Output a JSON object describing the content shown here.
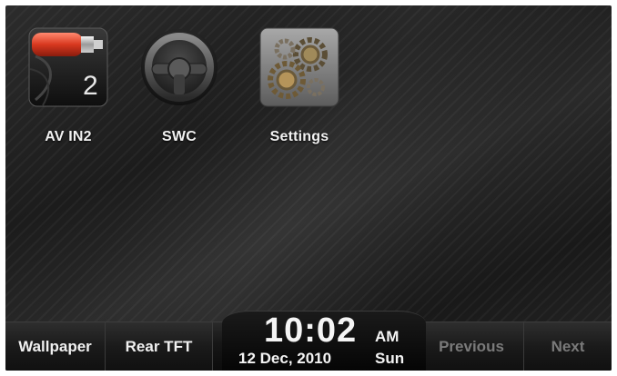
{
  "apps": [
    {
      "label": "AV IN2",
      "icon": "av-in2-icon",
      "badge_number": "2"
    },
    {
      "label": "SWC",
      "icon": "steering-wheel-icon"
    },
    {
      "label": "Settings",
      "icon": "gears-icon"
    }
  ],
  "bottom_bar": {
    "wallpaper_label": "Wallpaper",
    "rear_tft_label": "Rear TFT",
    "previous_label": "Previous",
    "next_label": "Next"
  },
  "clock": {
    "time": "10:02",
    "ampm": "AM",
    "date": "12 Dec, 2010",
    "day": "Sun"
  },
  "colors": {
    "background": "#222222",
    "label_text": "#f2f2f2",
    "disabled_text": "#7a7a7a",
    "av_cable_red": "#e0452e"
  }
}
